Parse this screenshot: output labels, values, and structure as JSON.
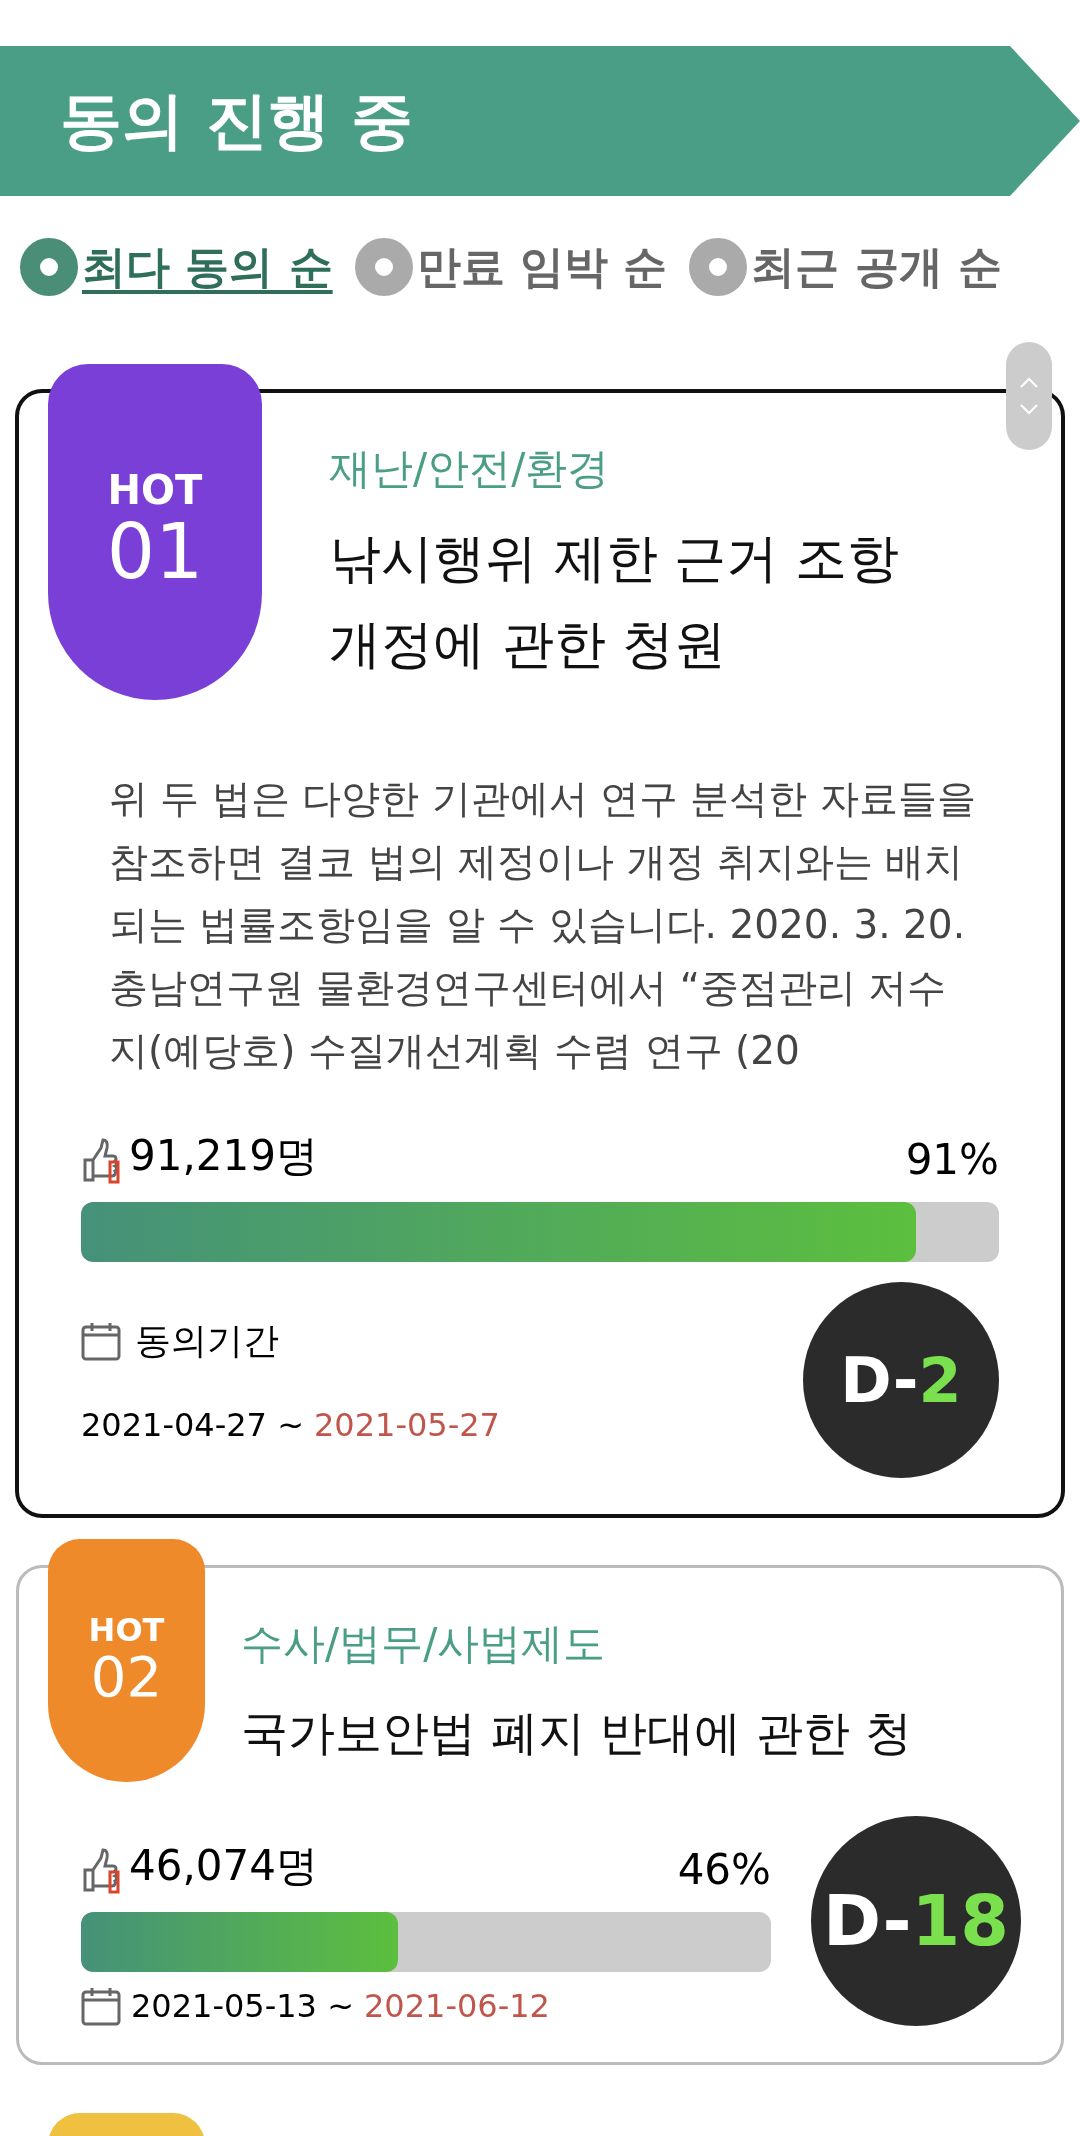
{
  "header": {
    "title": "동의 진행 중"
  },
  "sort_options": [
    {
      "label": "최다 동의 순",
      "selected": true
    },
    {
      "label": "만료 임박 순",
      "selected": false
    },
    {
      "label": "최근 공개 순",
      "selected": false
    }
  ],
  "petitions": [
    {
      "selected": true,
      "color": "#7a3fd6",
      "hot": "HOT",
      "rank": "01",
      "category": "재난/안전/환경",
      "title": "낚시행위 제한 근거 조항 개정에 관한 청원",
      "summary": "위 두 법은 다양한 기관에서 연구 분석한 자료들을 참조하면 결코 법의 제정이나 개정 취지와는 배치되는 법률조항임을 알 수 있습니다. 2020. 3. 20. 충남연구원 물환경연구센터에서 “중점관리 저수지(예당호) 수질개선계획 수렴 연구 (20",
      "count": "91,219명",
      "percent": "91%",
      "level": 0.91,
      "period_label": "동의기간",
      "start": "2021-04-27 ~",
      "end": "2021-05-27",
      "d_prefix": "D-",
      "d_days": "2"
    },
    {
      "selected": false,
      "color": "#ee8a2a",
      "hot": "HOT",
      "rank": "02",
      "category": "수사/법무/사법제도",
      "title": "국가보안법 폐지 반대에 관한 청",
      "count": "46,074명",
      "percent": "46%",
      "level": 0.46,
      "start": "2021-05-13 ~",
      "end": "2021-06-12",
      "d_prefix": "D-",
      "d_days": "18"
    },
    {
      "color": "#f0c040"
    }
  ]
}
